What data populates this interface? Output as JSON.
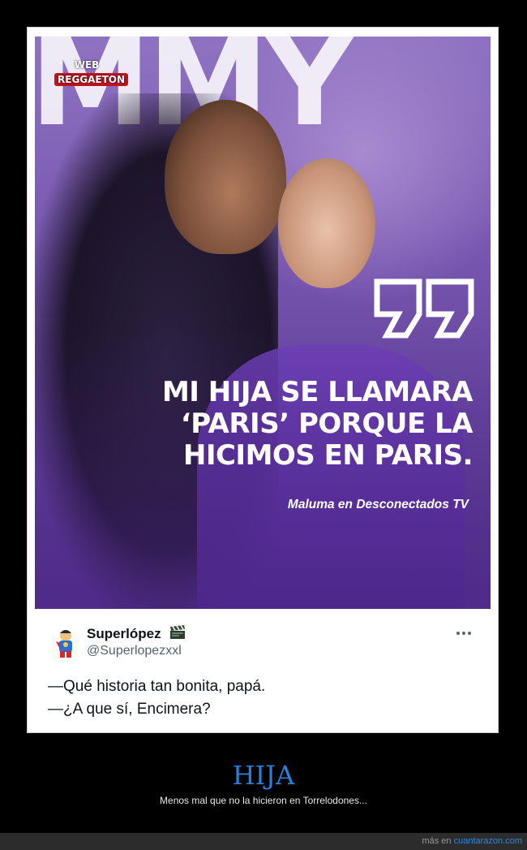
{
  "meme": {
    "logo_line1": "WEB",
    "logo_line2": "REGGAETON",
    "background_letters": "MMY",
    "quote_lines": [
      "MI HIJA SE LLAMARA",
      "‘PARIS’ PORQUE LA",
      "HICIMOS EN PARIS."
    ],
    "credit": "Maluma en Desconectados TV"
  },
  "tweet": {
    "name": "Superlópez",
    "handle": "@Superlopezxxl",
    "text_lines": [
      "—Qué historia tan bonita, papá.",
      "—¿A que sí, Encimera?"
    ],
    "avatar_icon": "superlopez-avatar-icon",
    "badge_icon": "clapperboard-icon",
    "menu_icon": "more-options-icon"
  },
  "post": {
    "title": "HIJA",
    "description": "Menos mal que no la hicieron en Torrelodones..."
  },
  "footer": {
    "prefix": "más en",
    "link_text": "cuantarazon.com"
  },
  "colors": {
    "title": "#2a7fd8",
    "link": "#2a8ae0",
    "photo_purple": "#7251ab",
    "logo_red": "#c1121f"
  }
}
